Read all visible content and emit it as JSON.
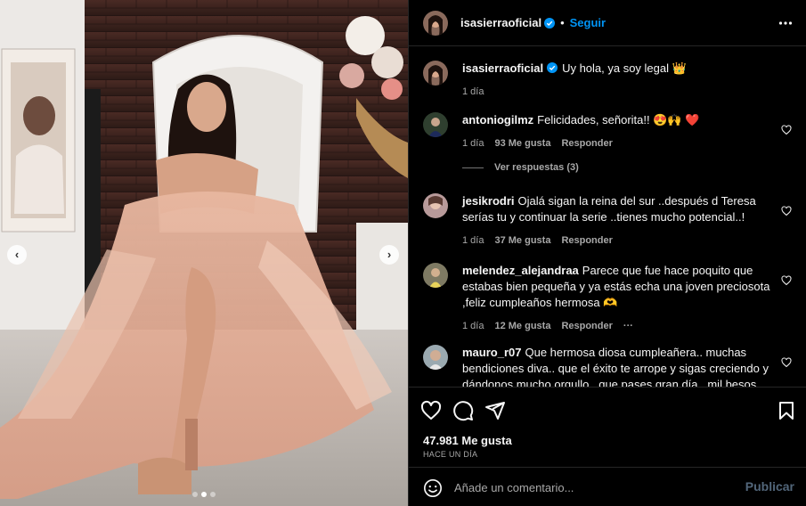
{
  "post_author": {
    "username": "isasierraoficial",
    "follow_label": "Seguir",
    "separator": "•"
  },
  "caption": {
    "username": "isasierraoficial",
    "text": "Uy hola, ya soy legal 👑",
    "time": "1 día"
  },
  "comments": [
    {
      "username": "antoniogilmz",
      "text": "Felicidades, señorita!! 😍🙌 ❤️",
      "time": "1 día",
      "likes": "93 Me gusta",
      "reply": "Responder",
      "view_replies": "Ver respuestas (3)"
    },
    {
      "username": "jesikrodri",
      "text": "Ojalá sigan la reina del sur ..después d Teresa serías tu y continuar la serie ..tienes mucho potencial..!",
      "time": "1 día",
      "likes": "37 Me gusta",
      "reply": "Responder"
    },
    {
      "username": "melendez_alejandraa",
      "text": "Parece que fue hace poquito que estabas bien pequeña y ya estás echa una joven preciosota ,feliz cumpleaños hermosa 🫶",
      "time": "1 día",
      "likes": "12 Me gusta",
      "reply": "Responder",
      "more": "···"
    },
    {
      "username": "mauro_r07",
      "text": "Que hermosa diosa cumpleañera.. muchas bendiciones diva.. que el éxito te arrope y sigas creciendo y dándonos mucho orgullo.. que pases gran día.. mil besos 🎂"
    }
  ],
  "stats": {
    "likes": "47.981 Me gusta",
    "date": "HACE UN DÍA"
  },
  "composer": {
    "placeholder": "Añade un comentario...",
    "publish_label": "Publicar"
  },
  "carousel": {
    "prev_glyph": "‹",
    "next_glyph": "›",
    "slide_count": 3,
    "active_slide": 2
  },
  "colors": {
    "accent": "#0095f6",
    "background": "#000000",
    "muted_text": "#a8a8a8",
    "publish_disabled": "#52667a"
  }
}
